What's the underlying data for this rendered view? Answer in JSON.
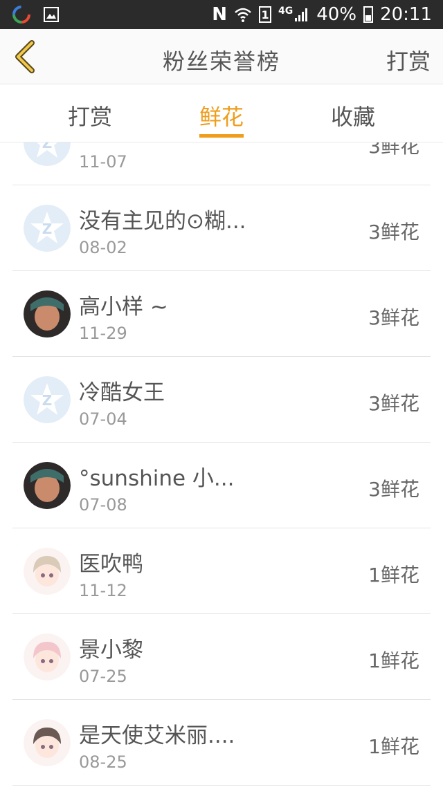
{
  "status_bar": {
    "network_type": "4G",
    "sim_slot": "1",
    "battery": "40%",
    "time": "20:11"
  },
  "header": {
    "title": "粉丝荣誉榜",
    "right_action": "打赏"
  },
  "tabs": [
    {
      "label": "打赏",
      "active": false
    },
    {
      "label": "鲜花",
      "active": true
    },
    {
      "label": "收藏",
      "active": false
    }
  ],
  "accent_color": "#ef9d1b",
  "fans": [
    {
      "name": "",
      "date": "11-07",
      "count": "3鲜花",
      "avatar": "default-avatar"
    },
    {
      "name": "没有主见的⊙糊...",
      "date": "08-02",
      "count": "3鲜花",
      "avatar": "default-avatar"
    },
    {
      "name": "高小样 ~",
      "date": "11-29",
      "count": "3鲜花",
      "avatar": "photo-avatar"
    },
    {
      "name": "冷酷女王",
      "date": "07-04",
      "count": "3鲜花",
      "avatar": "default-avatar"
    },
    {
      "name": "°sunshine 小...",
      "date": "07-08",
      "count": "3鲜花",
      "avatar": "photo-avatar"
    },
    {
      "name": "医吹鸭",
      "date": "11-12",
      "count": "1鲜花",
      "avatar": "anime-avatar"
    },
    {
      "name": "景小黎",
      "date": "07-25",
      "count": "1鲜花",
      "avatar": "anime-avatar"
    },
    {
      "name": "是天使艾米丽....",
      "date": "08-25",
      "count": "1鲜花",
      "avatar": "anime-avatar"
    }
  ]
}
